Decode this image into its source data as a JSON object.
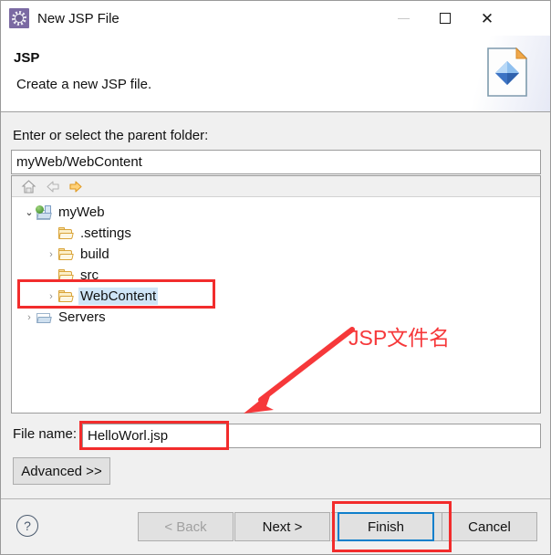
{
  "window": {
    "title": "New JSP File",
    "app_icon": "jsp-wizard-icon",
    "controls": {
      "minimize": "—",
      "maximize": "□",
      "close": "✕"
    }
  },
  "header": {
    "title": "JSP",
    "description": "Create a new JSP file.",
    "banner_icon": "jsp-file-document-icon"
  },
  "parent_folder": {
    "label": "Enter or select the parent folder:",
    "value": "myWeb/WebContent"
  },
  "tree_toolbar": {
    "home_icon": "home-icon",
    "back_icon": "back-arrow-icon",
    "forward_icon": "forward-arrow-icon"
  },
  "tree": {
    "items": [
      {
        "label": "myWeb",
        "icon": "project-icon",
        "indent": 0,
        "twisty": "⌄",
        "expanded": true,
        "selected": false
      },
      {
        "label": ".settings",
        "icon": "folder-icon",
        "indent": 1,
        "twisty": "",
        "expanded": false,
        "selected": false
      },
      {
        "label": "build",
        "icon": "folder-icon",
        "indent": 1,
        "twisty": "›",
        "expanded": false,
        "selected": false
      },
      {
        "label": "src",
        "icon": "folder-icon",
        "indent": 1,
        "twisty": "",
        "expanded": false,
        "selected": false
      },
      {
        "label": "WebContent",
        "icon": "folder-icon",
        "indent": 1,
        "twisty": "›",
        "expanded": false,
        "selected": true
      },
      {
        "label": "Servers",
        "icon": "servers-icon",
        "indent": 0,
        "twisty": "›",
        "expanded": false,
        "selected": false
      }
    ]
  },
  "file_name": {
    "label": "File name:",
    "value": "HelloWorl.jsp"
  },
  "advanced": {
    "label": "Advanced >>"
  },
  "footer": {
    "help_icon": "help-question-icon",
    "buttons": {
      "back": "< Back",
      "next": "Next >",
      "finish": "Finish",
      "cancel": "Cancel"
    }
  },
  "annotations": {
    "callout_text": "JSP文件名",
    "color": "#f6383a",
    "box_color": "#f22c2c",
    "boxes": [
      "webcontent-tree-row",
      "file-name-field",
      "finish-button"
    ],
    "arrow": "red-arrow-pointing-to-file-name"
  }
}
